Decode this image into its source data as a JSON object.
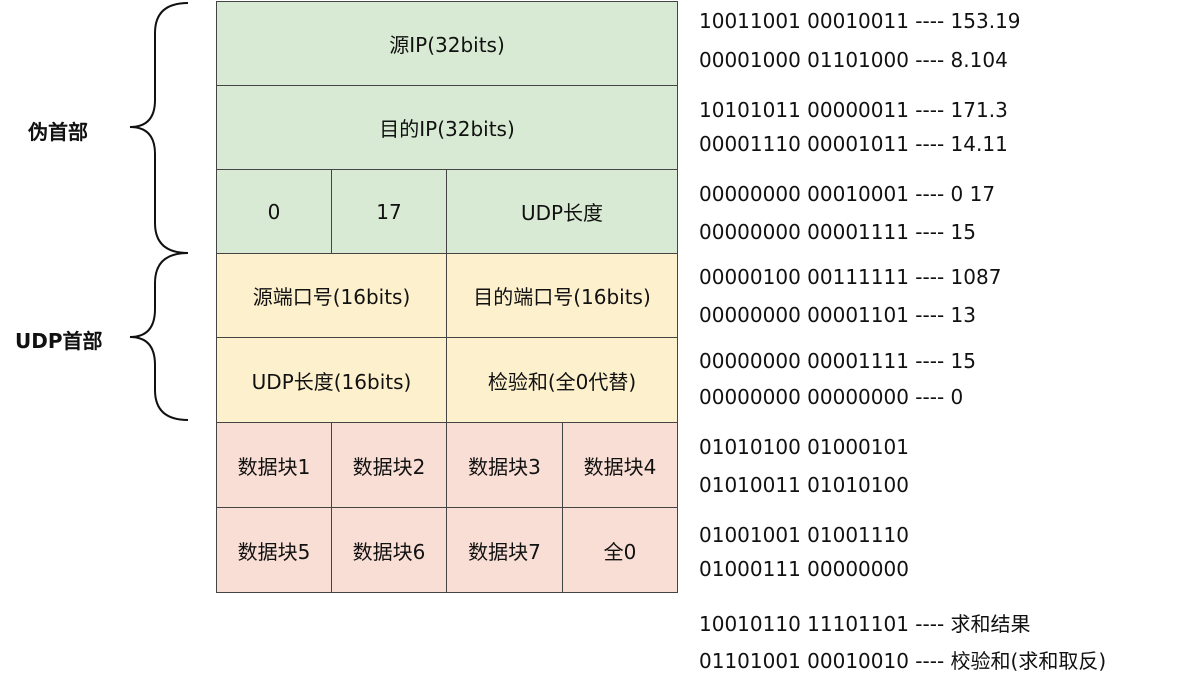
{
  "side_labels": {
    "pseudo_header": "伪首部",
    "udp_header": "UDP首部"
  },
  "table": {
    "src_ip": "源IP(32bits)",
    "dst_ip": "目的IP(32bits)",
    "zero": "0",
    "protocol": "17",
    "udp_length": "UDP长度",
    "src_port": "源端口号(16bits)",
    "dst_port": "目的端口号(16bits)",
    "udp_length_16": "UDP长度(16bits)",
    "checksum": "检验和(全0代替)",
    "data": [
      "数据块1",
      "数据块2",
      "数据块3",
      "数据块4",
      "数据块5",
      "数据块6",
      "数据块7",
      "全0"
    ]
  },
  "binary_rows": [
    "10011001 00010011 ---- 153.19",
    "00001000 01101000 ---- 8.104",
    "10101011 00000011 ---- 171.3",
    "00001110 00001011 ---- 14.11",
    "00000000 00010001 ---- 0 17",
    "00000000 00001111 ---- 15",
    "00000100 00111111 ---- 1087",
    "00000000 00001101 ---- 13",
    "00000000 00001111 ---- 15",
    "00000000 00000000 ---- 0",
    "01010100 01000101",
    "01010011 01010100",
    "01001001 01001110",
    "01000111 00000000",
    "10010110 11101101 ---- 求和结果",
    "01101001 00010010 ---- 校验和(求和取反)"
  ]
}
